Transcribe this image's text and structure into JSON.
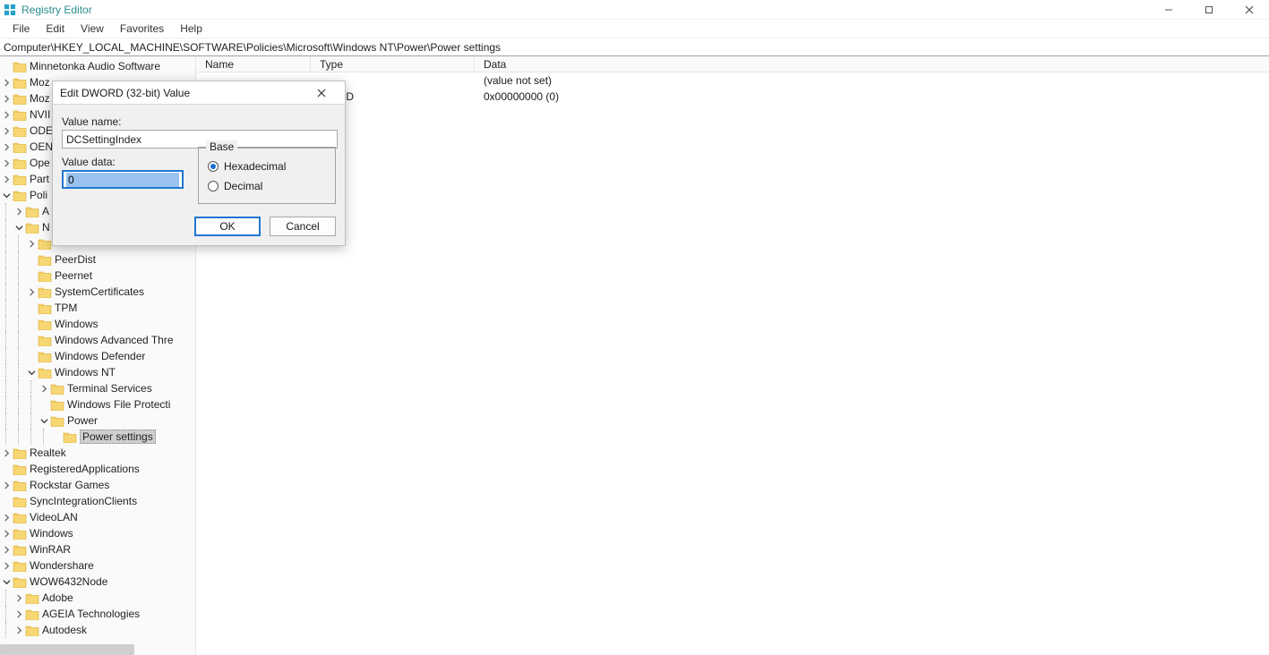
{
  "title": "Registry Editor",
  "menu": {
    "file": "File",
    "edit": "Edit",
    "view": "View",
    "favorites": "Favorites",
    "help": "Help"
  },
  "address": "Computer\\HKEY_LOCAL_MACHINE\\SOFTWARE\\Policies\\Microsoft\\Windows NT\\Power\\Power settings",
  "columns": {
    "name": "Name",
    "type": "Type",
    "data": "Data"
  },
  "rows": [
    {
      "name": "",
      "type": "",
      "data": "(value not set)"
    },
    {
      "name": "",
      "type": "WORD",
      "data": "0x00000000 (0)"
    }
  ],
  "tree": {
    "items": [
      {
        "depth": 1,
        "toggle": "none",
        "label": "Minnetonka Audio Software"
      },
      {
        "depth": 1,
        "toggle": "closed",
        "label": "Moz"
      },
      {
        "depth": 1,
        "toggle": "closed",
        "label": "Moz"
      },
      {
        "depth": 1,
        "toggle": "closed",
        "label": "NVII"
      },
      {
        "depth": 1,
        "toggle": "closed",
        "label": "ODE"
      },
      {
        "depth": 1,
        "toggle": "closed",
        "label": "OEN"
      },
      {
        "depth": 1,
        "toggle": "closed",
        "label": "Ope"
      },
      {
        "depth": 1,
        "toggle": "closed",
        "label": "Part"
      },
      {
        "depth": 1,
        "toggle": "open",
        "label": "Poli"
      },
      {
        "depth": 2,
        "toggle": "closed",
        "label": "A"
      },
      {
        "depth": 2,
        "toggle": "open",
        "label": "N"
      },
      {
        "depth": 3,
        "toggle": "closed",
        "label": ""
      },
      {
        "depth": 3,
        "toggle": "none",
        "label": "PeerDist"
      },
      {
        "depth": 3,
        "toggle": "none",
        "label": "Peernet"
      },
      {
        "depth": 3,
        "toggle": "closed",
        "label": "SystemCertificates"
      },
      {
        "depth": 3,
        "toggle": "none",
        "label": "TPM"
      },
      {
        "depth": 3,
        "toggle": "none",
        "label": "Windows"
      },
      {
        "depth": 3,
        "toggle": "none",
        "label": "Windows Advanced Thre"
      },
      {
        "depth": 3,
        "toggle": "none",
        "label": "Windows Defender"
      },
      {
        "depth": 3,
        "toggle": "open",
        "label": "Windows NT"
      },
      {
        "depth": 4,
        "toggle": "closed",
        "label": "Terminal Services"
      },
      {
        "depth": 4,
        "toggle": "none",
        "label": "Windows File Protecti"
      },
      {
        "depth": 4,
        "toggle": "open",
        "label": "Power"
      },
      {
        "depth": 5,
        "toggle": "none",
        "label": "Power settings",
        "selected": true
      },
      {
        "depth": 1,
        "toggle": "closed",
        "label": "Realtek"
      },
      {
        "depth": 1,
        "toggle": "none",
        "label": "RegisteredApplications"
      },
      {
        "depth": 1,
        "toggle": "closed",
        "label": "Rockstar Games"
      },
      {
        "depth": 1,
        "toggle": "none",
        "label": "SyncIntegrationClients"
      },
      {
        "depth": 1,
        "toggle": "closed",
        "label": "VideoLAN"
      },
      {
        "depth": 1,
        "toggle": "closed",
        "label": "Windows"
      },
      {
        "depth": 1,
        "toggle": "closed",
        "label": "WinRAR"
      },
      {
        "depth": 1,
        "toggle": "closed",
        "label": "Wondershare"
      },
      {
        "depth": 1,
        "toggle": "open",
        "label": "WOW6432Node"
      },
      {
        "depth": 2,
        "toggle": "closed",
        "label": "Adobe"
      },
      {
        "depth": 2,
        "toggle": "closed",
        "label": "AGEIA Technologies"
      },
      {
        "depth": 2,
        "toggle": "closed",
        "label": "Autodesk"
      }
    ]
  },
  "dialog": {
    "title": "Edit DWORD (32-bit) Value",
    "value_name_label": "Value name:",
    "value_name": "DCSettingIndex",
    "value_data_label": "Value data:",
    "value_data": "0",
    "base_label": "Base",
    "hex_label": "Hexadecimal",
    "dec_label": "Decimal",
    "ok": "OK",
    "cancel": "Cancel"
  }
}
